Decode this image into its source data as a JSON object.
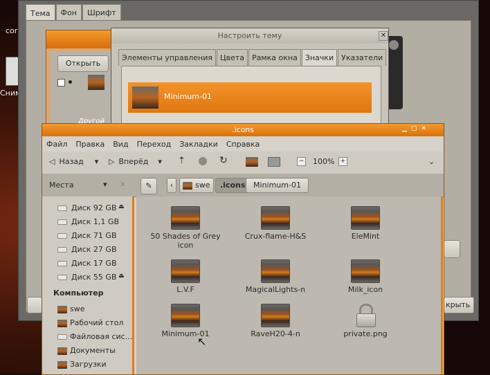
{
  "desktop": {
    "label_top": "cor",
    "label_side": "Сним"
  },
  "appearance": {
    "tabs": [
      "Тема",
      "Фон",
      "Шрифт"
    ],
    "open_button": "Открыть",
    "theme_label": "Другой",
    "close_button_partial": "крыть"
  },
  "customize": {
    "title": "Настроить тему",
    "tabs": [
      "Элементы управления",
      "Цвета",
      "Рамка окна",
      "Значки",
      "Указатели"
    ],
    "active_tab": "Значки",
    "selected_theme": "Minimum-01"
  },
  "file_manager": {
    "title": ".icons",
    "menu": [
      "Файл",
      "Правка",
      "Вид",
      "Переход",
      "Закладки",
      "Справка"
    ],
    "toolbar": {
      "back": "Назад",
      "forward": "Вперёд",
      "zoom": "100%"
    },
    "sidebar_header": "Места",
    "path": [
      "swe",
      ".icons",
      "Minimum-01"
    ],
    "drives": [
      "Диск 92 GB",
      "Диск 1,1 GB",
      "Диск 71 GB",
      "Диск 27 GB",
      "Диск 17 GB",
      "Диск 55 GB"
    ],
    "computer_header": "Компьютер",
    "computer_items": [
      "swe",
      "Рабочий стол",
      "Файловая сис...",
      "Документы",
      "Загрузки"
    ],
    "files": [
      "50 Shades of Grey icon",
      "Crux-flame-H&S",
      "EleMint",
      "L.V.F",
      "MagicalLights-n",
      "Milk_icon",
      "Minimum-01",
      "RaveH20-4-n",
      "private.png"
    ]
  }
}
